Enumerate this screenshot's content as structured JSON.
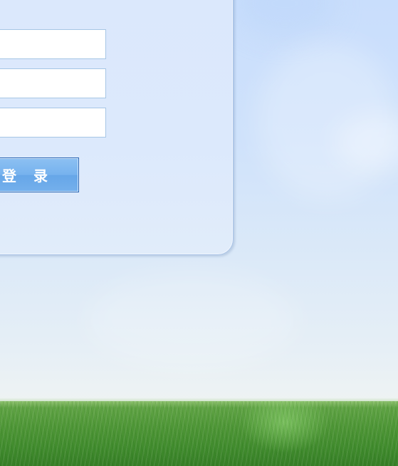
{
  "login_form": {
    "fields": [
      {
        "value": "",
        "placeholder": ""
      },
      {
        "value": "",
        "placeholder": ""
      },
      {
        "value": "",
        "placeholder": ""
      }
    ],
    "submit_label": "登　录"
  },
  "colors": {
    "sky": "#cfe2fb",
    "panel": "#dbe8fc",
    "button": "#76b2ee",
    "grass": "#4e9636"
  }
}
